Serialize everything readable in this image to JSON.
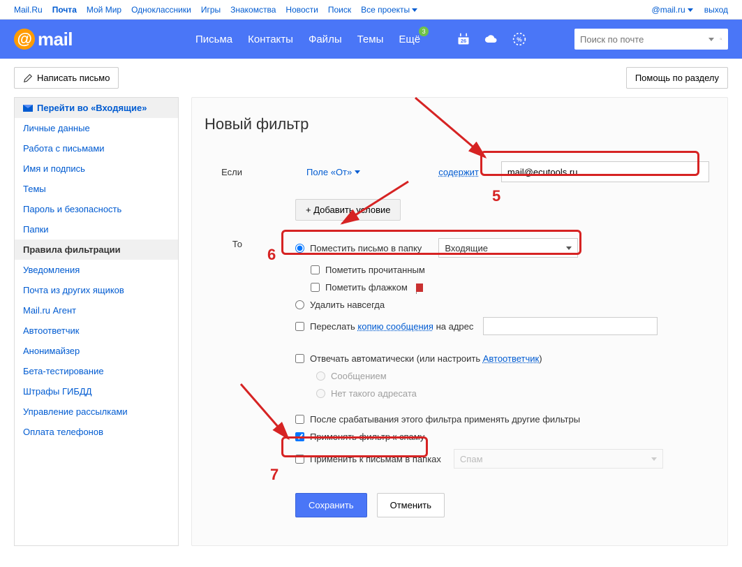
{
  "topbar": {
    "links": [
      "Mail.Ru",
      "Почта",
      "Мой Мир",
      "Одноклассники",
      "Игры",
      "Знакомства",
      "Новости",
      "Поиск",
      "Все проекты"
    ],
    "active_index": 1,
    "user_email": "@mail.ru",
    "logout": "выход"
  },
  "header": {
    "logo_text": "mail",
    "nav": [
      "Письма",
      "Контакты",
      "Файлы",
      "Темы",
      "Ещё"
    ],
    "badge": "3",
    "search_placeholder": "Поиск по почте",
    "calendar_day": "26"
  },
  "actions": {
    "compose": "Написать письмо",
    "help": "Помощь по разделу"
  },
  "sidebar": {
    "inbox": "Перейти во «Входящие»",
    "items": [
      "Личные данные",
      "Работа с письмами",
      "Имя и подпись",
      "Темы",
      "Пароль и безопасность",
      "Папки",
      "Правила фильтрации",
      "Уведомления",
      "Почта из других ящиков",
      "Mail.ru Агент",
      "Автоответчик",
      "Анонимайзер",
      "Бета-тестирование",
      "Штрафы ГИБДД",
      "Управление рассылками",
      "Оплата телефонов"
    ],
    "active": "Правила фильтрации"
  },
  "page": {
    "title": "Новый фильтр",
    "if_label": "Если",
    "field_from": "Поле «От»",
    "contains": "содержит",
    "value": "mail@ecutools.ru",
    "add_condition": "+  Добавить условие",
    "to_label": "То",
    "move_to_folder": "Поместить письмо в папку",
    "folder_selected": "Входящие",
    "mark_read": "Пометить прочитанным",
    "mark_flag": "Пометить флажком",
    "delete_forever": "Удалить навсегда",
    "forward_prefix": "Переслать ",
    "forward_link": "копию сообщения",
    "forward_suffix": " на адрес",
    "autoreply_prefix": "Отвечать автоматически (или настроить ",
    "autoreply_link": "Автоответчик",
    "autoreply_suffix": ")",
    "reply_message": "Сообщением",
    "no_recipient": "Нет такого адресата",
    "apply_others": "После срабатывания этого фильтра применять другие фильтры",
    "apply_spam": "Применять фильтр к спаму",
    "apply_folders": "Применить к письмам в папках",
    "folders_value": "Спам",
    "save": "Сохранить",
    "cancel": "Отменить"
  },
  "annotations": {
    "n5": "5",
    "n6": "6",
    "n7": "7"
  }
}
